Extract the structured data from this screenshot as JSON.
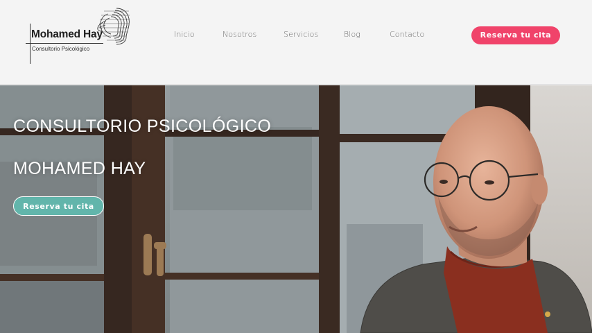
{
  "brand": {
    "name": "Mohamed Hay",
    "subtitle": "Consultorio Psicológico",
    "logo_icon": "head-profile-icon"
  },
  "nav": {
    "items": [
      {
        "label": "Inicio"
      },
      {
        "label": "Nosotros"
      },
      {
        "label": "Servicios"
      },
      {
        "label": "Blog"
      },
      {
        "label": "Contacto"
      }
    ]
  },
  "header": {
    "cta_label": "Reserva tu cita"
  },
  "hero": {
    "line1": "CONSULTORIO PSICOLÓGICO",
    "line2": "MOHAMED HAY",
    "cta_label": "Reserva tu cita"
  },
  "colors": {
    "background": "#f4f4f4",
    "cta_top": "#f0436a",
    "cta_hero": "#62b5ab",
    "hero_text": "#ffffff"
  }
}
